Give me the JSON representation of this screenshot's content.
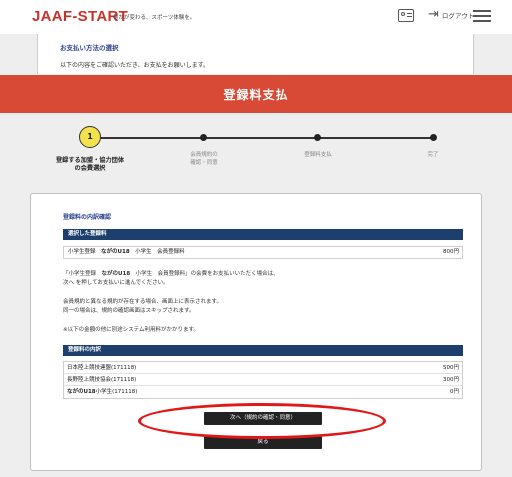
{
  "header": {
    "logo": "JAAF-START",
    "tagline": "何かが変わる、スポーツ体験を。",
    "logout_label": "ログアウト"
  },
  "top_panel": {
    "title": "お支払い方法の選択",
    "text": "以下の内容をご確認いただき、お支払をお願いします。"
  },
  "banner": {
    "title": "登録料支払"
  },
  "stepper": {
    "steps": [
      {
        "number": "1",
        "label_line1": "登録する加盟・協力団体",
        "label_line2": "の会費選択"
      },
      {
        "label_line1": "会員規約の",
        "label_line2": "確認・同意"
      },
      {
        "label_line1": "登録料支払"
      },
      {
        "label_line1": "完了"
      }
    ]
  },
  "main": {
    "section_title": "登録料の内訳確認",
    "selected_header": "選択した登録料",
    "fee": {
      "prefix": "小学生登録",
      "club": "ながのU18",
      "suffix": "小学生　会員登録料",
      "amount": "800円"
    },
    "para1": {
      "prefix": "「小学生登録",
      "club": "ながのU18",
      "suffix": "小学生　会員登録料」の会費をお支払いいただく場合は、",
      "line2": "次へ を押してお支払いに進んでください。"
    },
    "para2": {
      "line1": "会員規約と異なる規約が存在する場合、画面上に表示されます。",
      "line2": "同一の場合は、規約の確認画面はスキップされます。"
    },
    "para3": "※以下の金額の他に別途システム利用料がかかります。",
    "breakdown_header": "登録料の内訳",
    "breakdown": [
      {
        "name": "日本陸上競技連盟(171118)",
        "amount": "500円"
      },
      {
        "name": "長野陸上競技協会(171118)",
        "amount": "300円"
      },
      {
        "name_bold": "ながのU18",
        "name_rest": "小学生(171118)",
        "amount": "0円"
      }
    ],
    "next_button": "次へ（規約の確認・同意）",
    "back_button": "戻る"
  },
  "colors": {
    "brand_red": "#d84a35",
    "navy": "#1c3f6e",
    "step_active": "#f3e24b",
    "highlight": "#e01818"
  }
}
